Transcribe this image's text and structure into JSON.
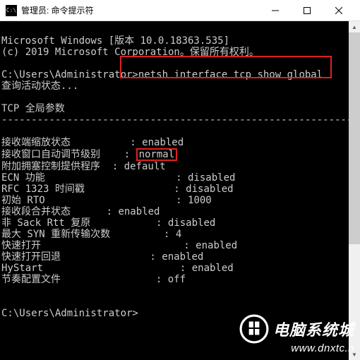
{
  "titlebar": {
    "icon_text": "C:\\",
    "title": "管理员: 命令提示符"
  },
  "console": {
    "line1": "Microsoft Windows [版本 10.0.18363.535]",
    "line2": "(c) 2019 Microsoft Corporation。保留所有权利。",
    "prompt1_path": "C:\\Users\\Administrator>",
    "prompt1_cmd": "netsh interface tcp show global",
    "querying": "查询活动状态...",
    "section_header": "TCP 全局参数",
    "dashes": "----------------------------------------------------------------------",
    "rows": [
      {
        "label": "接收端缩放状态          : ",
        "value": "enabled"
      },
      {
        "label": "接收窗口自动调节级别    : ",
        "value": "normal",
        "hl": true
      },
      {
        "label": "附加拥塞控制提供程序  : ",
        "value": "default"
      },
      {
        "label": "ECN 功能                      : ",
        "value": "disabled"
      },
      {
        "label": "RFC 1323 时间戳               : ",
        "value": "disabled"
      },
      {
        "label": "初始 RTO                      : ",
        "value": "1000"
      },
      {
        "label": "接收段合并状态      : ",
        "value": "enabled"
      },
      {
        "label": "非 Sack Rtt 复原           : ",
        "value": "disabled"
      },
      {
        "label": "最大 SYN 重新传输次数         : ",
        "value": "4"
      },
      {
        "label": "快速打开                        : ",
        "value": "enabled"
      },
      {
        "label": "快速打开回退               : ",
        "value": "enabled"
      },
      {
        "label": "HyStart                       : ",
        "value": "enabled"
      },
      {
        "label": "节奏配置文件                : ",
        "value": "off"
      }
    ],
    "prompt2": "C:\\Users\\Administrator>"
  },
  "watermark": {
    "title": "电脑系统城",
    "url": "www.dnxtc.n"
  }
}
